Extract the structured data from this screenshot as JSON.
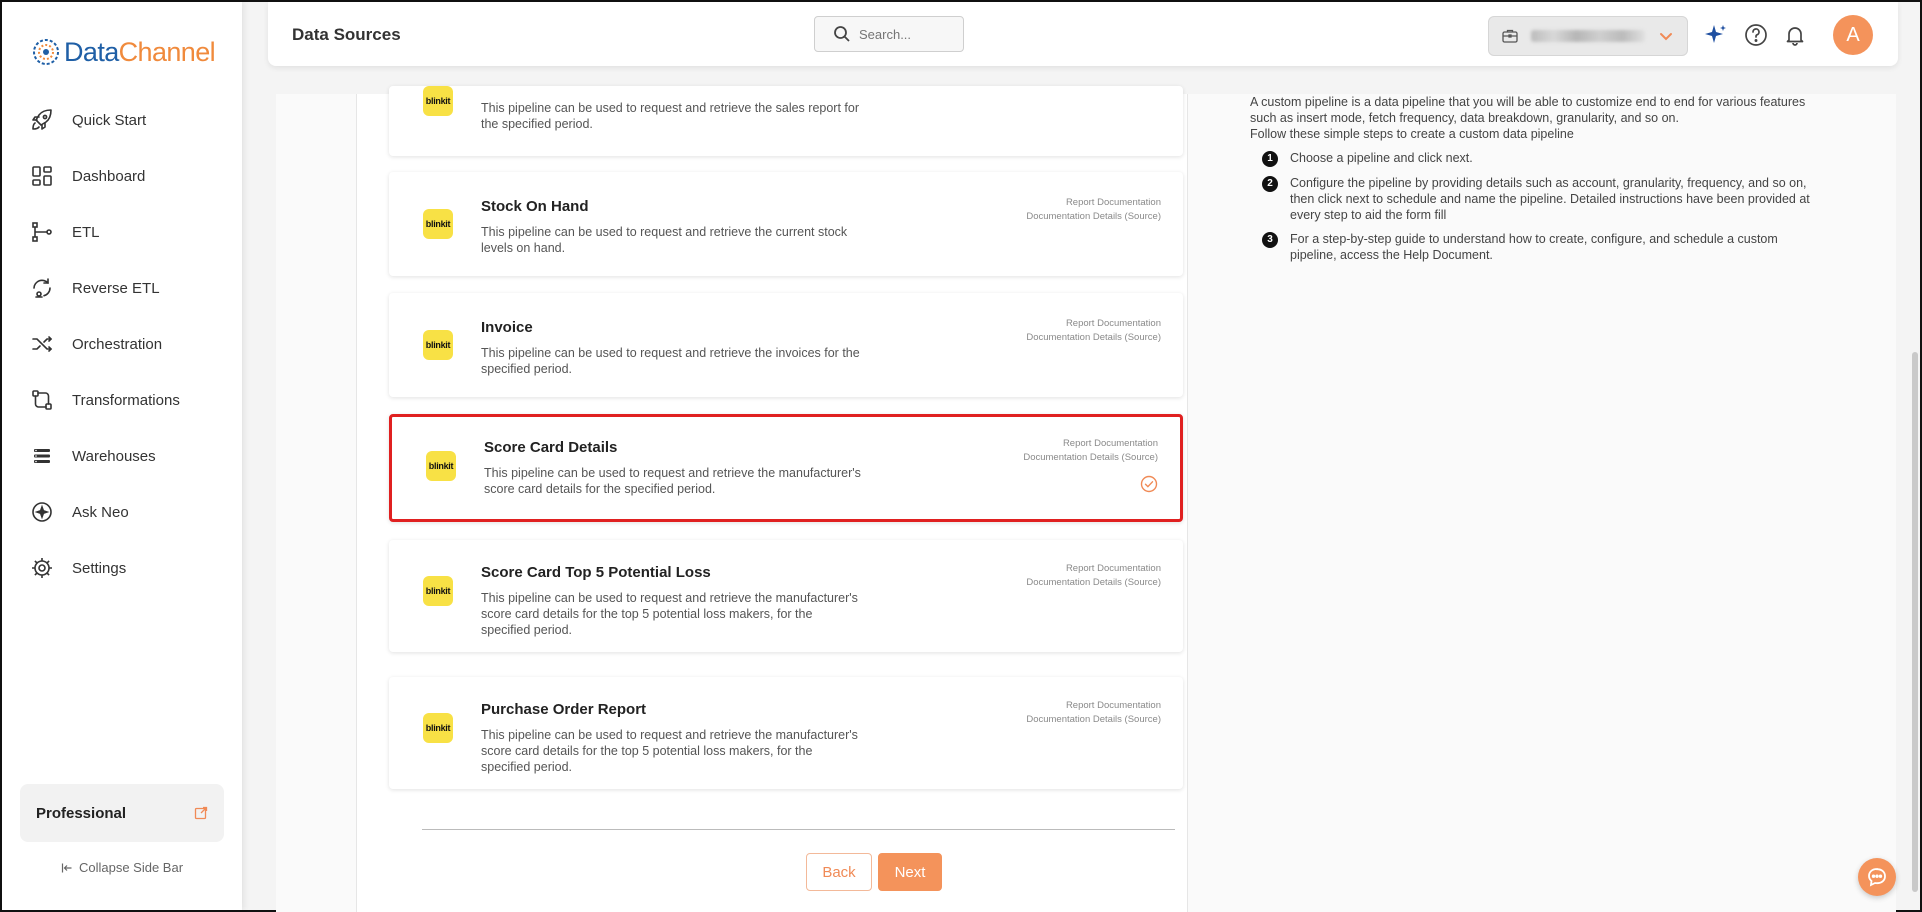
{
  "brand": {
    "part1": "Data",
    "part2": "Channel"
  },
  "colors": {
    "accent": "#f4935b",
    "brand_blue": "#1f5fa6",
    "selected_border": "#e02020",
    "logo_yellow": "#f8e145"
  },
  "sidebar": {
    "items": [
      {
        "label": "Quick Start",
        "icon": "rocket-icon"
      },
      {
        "label": "Dashboard",
        "icon": "dashboard-icon"
      },
      {
        "label": "ETL",
        "icon": "etl-icon"
      },
      {
        "label": "Reverse ETL",
        "icon": "reverse-etl-icon"
      },
      {
        "label": "Orchestration",
        "icon": "orchestration-icon"
      },
      {
        "label": "Transformations",
        "icon": "transformations-icon"
      },
      {
        "label": "Warehouses",
        "icon": "warehouses-icon"
      },
      {
        "label": "Ask Neo",
        "icon": "ask-neo-icon"
      },
      {
        "label": "Settings",
        "icon": "settings-icon"
      }
    ],
    "plan": "Professional",
    "collapse_label": "Collapse Side Bar"
  },
  "header": {
    "title": "Data Sources",
    "search_placeholder": "Search...",
    "avatar_initial": "A"
  },
  "cards": [
    {
      "title": "",
      "logo": "blinkit",
      "description": "This pipeline can be used to request and retrieve the sales report for the specified period.",
      "links": []
    },
    {
      "title": "Stock On Hand",
      "logo": "blinkit",
      "description": "This pipeline can be used to request and retrieve the current stock levels on hand.",
      "links": [
        "Report Documentation",
        "Documentation Details (Source)"
      ]
    },
    {
      "title": "Invoice",
      "logo": "blinkit",
      "description": "This pipeline can be used to request and retrieve the invoices for the specified period.",
      "links": [
        "Report Documentation",
        "Documentation Details (Source)"
      ]
    },
    {
      "title": "Score Card Details",
      "logo": "blinkit",
      "description": "This pipeline can be used to request and retrieve the manufacturer's score card details for the specified period.",
      "links": [
        "Report Documentation",
        "Documentation Details (Source)"
      ]
    },
    {
      "title": "Score Card Top 5 Potential Loss",
      "logo": "blinkit",
      "description": "This pipeline can be used to request and retrieve the manufacturer's score card details for the top 5 potential loss makers, for the specified period.",
      "links": [
        "Report Documentation",
        "Documentation Details (Source)"
      ]
    },
    {
      "title": "Purchase Order Report",
      "logo": "blinkit",
      "description": "This pipeline can be used to request and retrieve the manufacturer's score card details for the top 5 potential loss makers, for the specified period.",
      "links": [
        "Report Documentation",
        "Documentation Details (Source)"
      ]
    }
  ],
  "selected_card": "Score Card Details",
  "buttons": {
    "back": "Back",
    "next": "Next"
  },
  "info": {
    "intro": "A custom pipeline is a data pipeline that you will be able to customize end to end for various features such as insert mode, fetch frequency, data breakdown, granularity, and so on.",
    "follow": "Follow these simple steps to create a custom data pipeline",
    "steps": [
      {
        "num": "1",
        "text": "Choose a pipeline and click next."
      },
      {
        "num": "2",
        "text": "Configure the pipeline by providing details such as account, granularity, frequency, and so on, then click next to schedule and name the pipeline. Detailed instructions have been provided at every step to aid the form fill"
      },
      {
        "num": "3",
        "text": "For a step-by-step guide to understand how to create, configure, and schedule a custom pipeline, access the Help Document."
      }
    ]
  }
}
